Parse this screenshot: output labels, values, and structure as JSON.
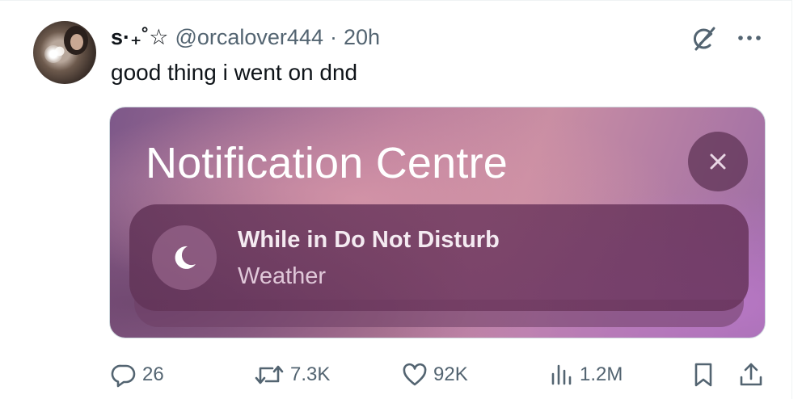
{
  "tweet": {
    "display_name": "s·₊˚☆",
    "handle": "@orcalover444",
    "separator": "·",
    "time": "20h",
    "text": "good thing i went on dnd"
  },
  "media": {
    "title": "Notification Centre",
    "notification": {
      "line1": "While in Do Not Disturb",
      "line2": "Weather"
    },
    "icons": [
      "close-icon",
      "moon-icon"
    ]
  },
  "actions": {
    "replies": "26",
    "retweets": "7.3K",
    "likes": "92K",
    "views": "1.2M"
  },
  "icons": {
    "grok": "grok-icon",
    "more": "more-icon",
    "reply": "reply-icon",
    "retweet": "retweet-icon",
    "like": "heart-icon",
    "views": "views-icon",
    "bookmark": "bookmark-icon",
    "share": "share-icon"
  },
  "colors": {
    "text_primary": "#0f1419",
    "text_secondary": "#536471",
    "border": "#cfd9de"
  }
}
